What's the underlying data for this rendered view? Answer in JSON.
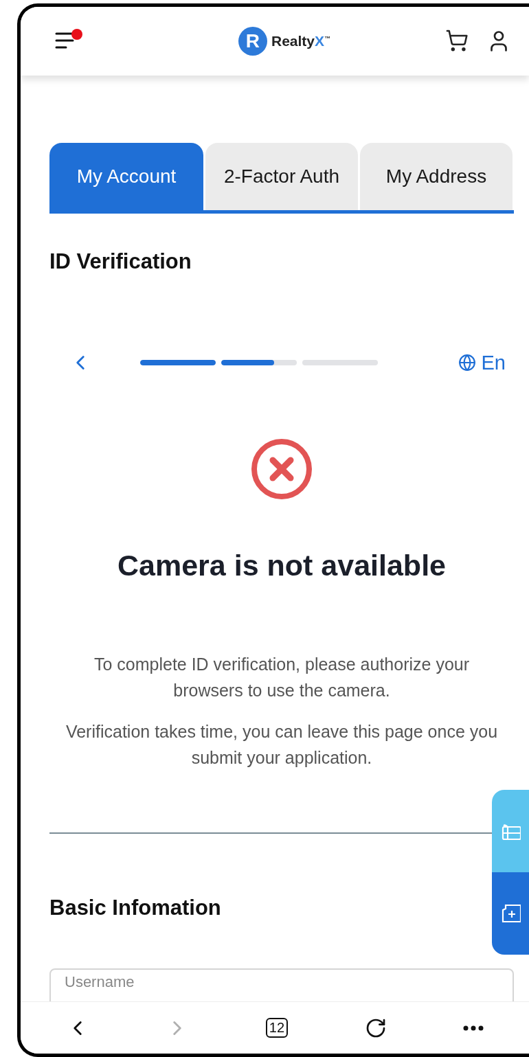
{
  "header": {
    "menu_badge": true,
    "logo": {
      "letter": "R",
      "name": "Realty",
      "accent": "X",
      "mark": "™"
    }
  },
  "tabs": [
    {
      "label": "My Account",
      "selected": true
    },
    {
      "label": "2-Factor Auth",
      "selected": false
    },
    {
      "label": "My Address",
      "selected": false
    }
  ],
  "section_title": "ID Verification",
  "stepper": {
    "segments": [
      {
        "level": 1
      },
      {
        "level": 0.7
      },
      {
        "level": 0
      }
    ],
    "language": "En"
  },
  "error": {
    "title": "Camera is not available",
    "paragraphs": [
      "To complete ID verification, please authorize your browsers to use the camera.",
      "Verification takes time, you can leave this page once you submit your application."
    ]
  },
  "form": {
    "title": "Basic Infomation",
    "fields": [
      {
        "placeholder": "Username"
      }
    ]
  },
  "browser_bar": {
    "tab_count": "12",
    "forward_disabled": true
  }
}
